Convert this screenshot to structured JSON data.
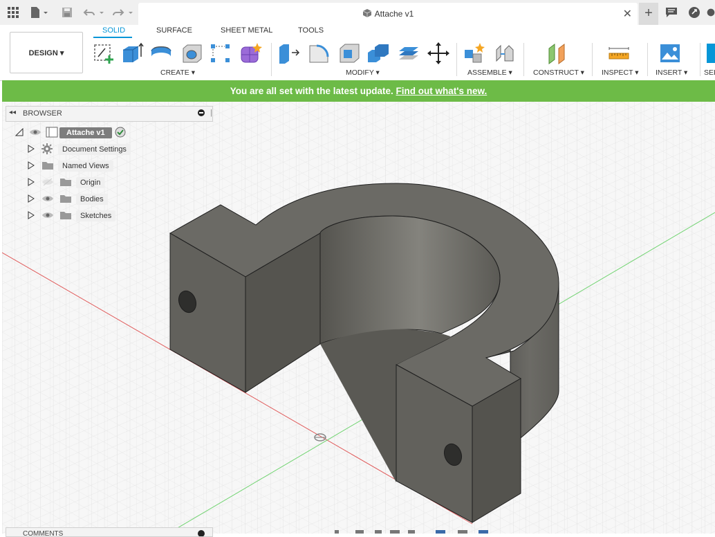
{
  "window": {
    "document_title": "Attache v1"
  },
  "ribbon": {
    "mode_label": "DESIGN ▾",
    "tabs": [
      {
        "label": "SOLID",
        "active": true
      },
      {
        "label": "SURFACE"
      },
      {
        "label": "SHEET METAL"
      },
      {
        "label": "TOOLS"
      }
    ],
    "groups": {
      "create": "CREATE ▾",
      "modify": "MODIFY ▾",
      "assemble": "ASSEMBLE ▾",
      "construct": "CONSTRUCT ▾",
      "inspect": "INSPECT ▾",
      "insert": "INSERT ▾",
      "select": "SEL"
    }
  },
  "banner": {
    "text": "You are all set with the latest update.",
    "link": "Find out what's new."
  },
  "browser": {
    "title": "BROWSER",
    "root": "Attache v1",
    "items": [
      {
        "label": "Document Settings",
        "icon": "gear-icon"
      },
      {
        "label": "Named Views",
        "icon": "folder-icon"
      },
      {
        "label": "Origin",
        "icon": "folder-icon",
        "hidden": true
      },
      {
        "label": "Bodies",
        "icon": "folder-icon"
      },
      {
        "label": "Sketches",
        "icon": "folder-icon"
      }
    ]
  },
  "comments": {
    "title": "COMMENTS"
  },
  "colors": {
    "accent": "#0696d7",
    "banner": "#6dbb47",
    "model": "#5f5e59",
    "grid": "#dcdcdc"
  }
}
